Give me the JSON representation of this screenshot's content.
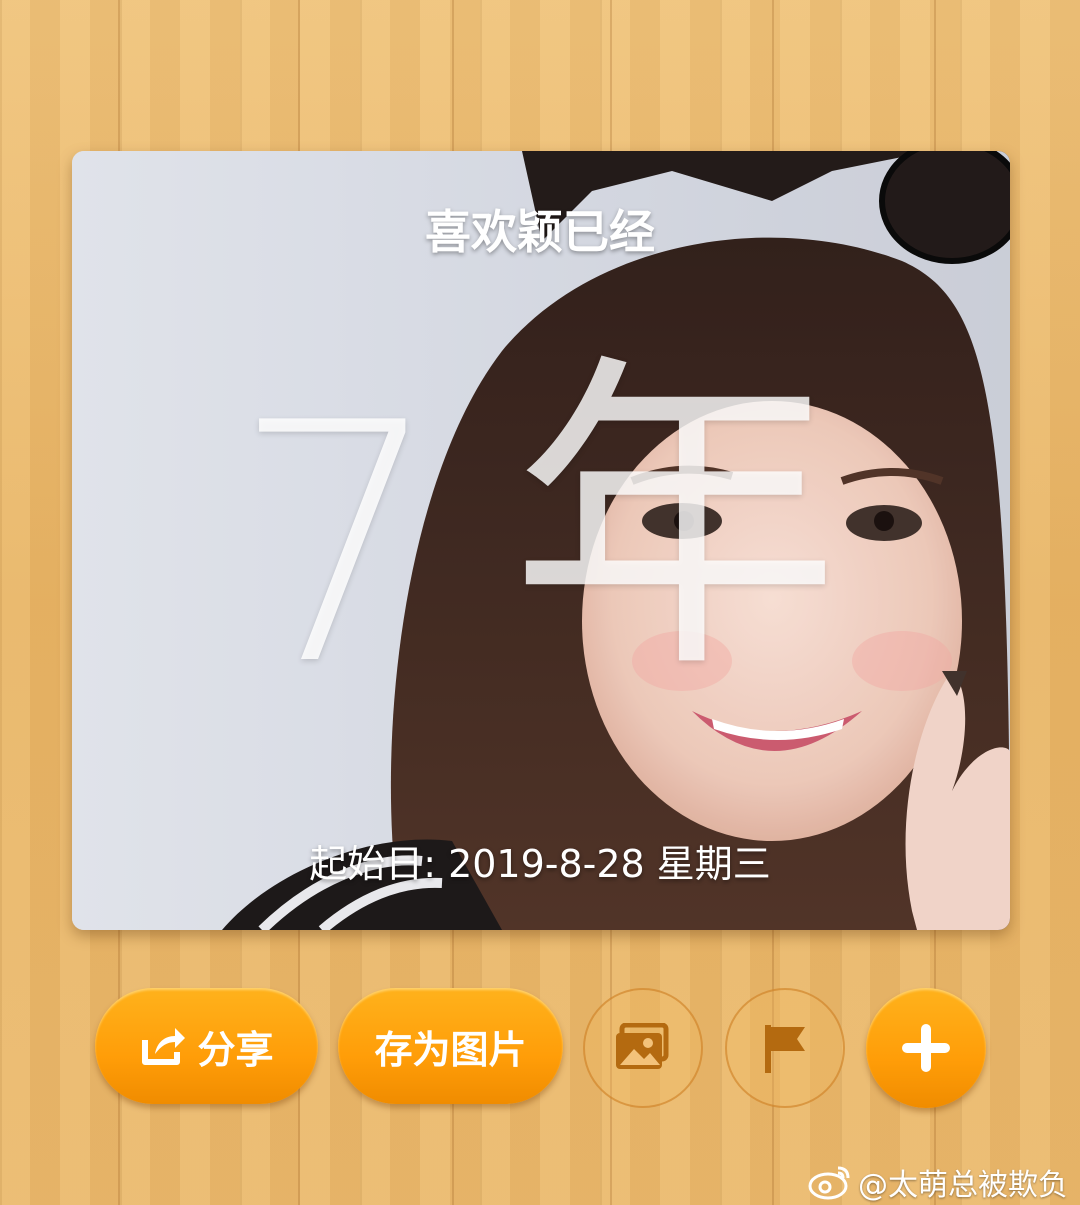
{
  "card": {
    "title": "喜欢颖已经",
    "count_number": "7",
    "count_unit": "年",
    "start_date_text": "起始日: 2019-8-28 星期三"
  },
  "actions": {
    "share_label": "分享",
    "save_image_label": "存为图片"
  },
  "watermark": {
    "text": "@太萌总被欺负"
  },
  "icons": {
    "share": "share-icon",
    "gallery": "gallery-icon",
    "flag": "flag-icon",
    "add": "plus-icon",
    "weibo": "weibo-logo-icon"
  },
  "colors": {
    "accent_orange": "#ff9d08",
    "wood": "#e8b465",
    "text_on_accent": "#ffffff"
  }
}
